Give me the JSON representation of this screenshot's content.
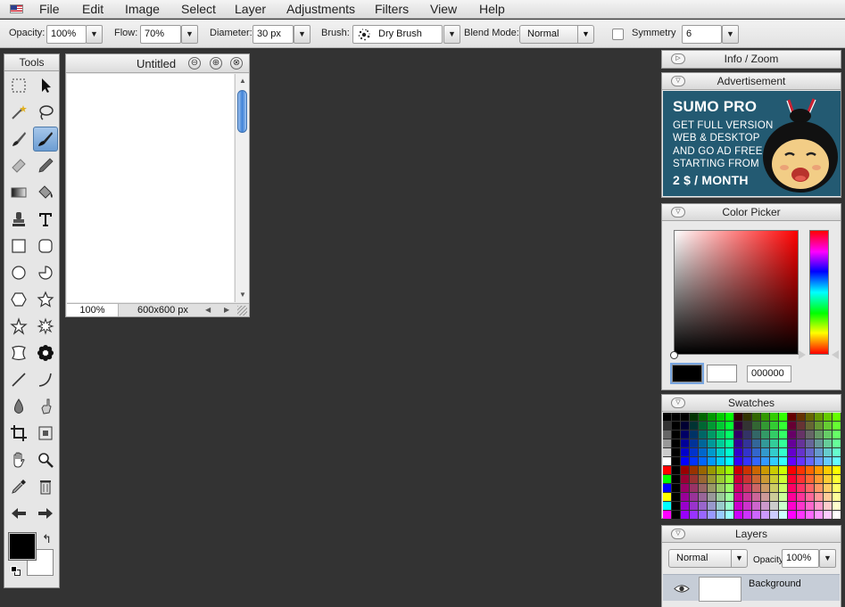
{
  "menu": {
    "items": [
      "File",
      "Edit",
      "Image",
      "Select",
      "Layer",
      "Adjustments",
      "Filters",
      "View",
      "Help"
    ]
  },
  "options": {
    "opacity_label": "Opacity:",
    "opacity_value": "100%",
    "flow_label": "Flow:",
    "flow_value": "70%",
    "diameter_label": "Diameter:",
    "diameter_value": "30 px",
    "brush_label": "Brush:",
    "brush_value": "Dry Brush",
    "blend_label": "Blend Mode:",
    "blend_value": "Normal",
    "symmetry_label": "Symmetry",
    "symmetry_value": "6",
    "dropdown_glyph": "▼"
  },
  "tools_panel": {
    "title": "Tools"
  },
  "document": {
    "title": "Untitled",
    "zoom": "100%",
    "size": "600x600 px",
    "minimize_glyph": "⊖",
    "maximize_glyph": "⊕",
    "close_glyph": "⊗",
    "scroll_up": "▲",
    "scroll_down": "▼",
    "scroll_left": "◀",
    "scroll_right": "▶"
  },
  "panels": {
    "info_zoom": "Info / Zoom",
    "advertisement": "Advertisement",
    "color_picker": "Color Picker",
    "swatches": "Swatches",
    "layers": "Layers"
  },
  "ad": {
    "brand": "SUMO PRO",
    "lines": [
      "GET FULL VERSION",
      "WEB & DESKTOP",
      "AND GO AD FREE",
      "STARTING FROM"
    ],
    "price": "2 $ / MONTH"
  },
  "color_picker": {
    "hex_value": "000000",
    "foreground": "#000000",
    "background": "#ffffff"
  },
  "layers": {
    "blend_mode": "Normal",
    "opacity_label": "Opacity:",
    "opacity_value": "100%",
    "layer_name": "Background"
  },
  "colors": {
    "workspace": "#333333",
    "accent": "#3f83d8"
  }
}
